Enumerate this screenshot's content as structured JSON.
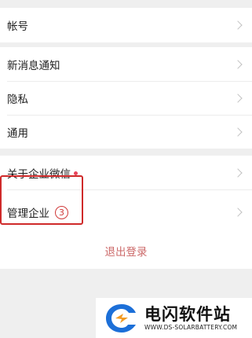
{
  "settings": {
    "group1": [
      {
        "label": "帐号"
      }
    ],
    "group2": [
      {
        "label": "新消息通知"
      },
      {
        "label": "隐私"
      },
      {
        "label": "通用"
      }
    ],
    "group3": [
      {
        "label": "关于企业微信",
        "has_dot": true
      },
      {
        "label": "管理企业",
        "step_badge": "3"
      }
    ]
  },
  "logout_label": "退出登录",
  "watermark": {
    "title": "电闪软件站",
    "url": "WWW.DS-SOLARBATTERY.COM"
  },
  "colors": {
    "accent_red": "#e8455b",
    "highlight_red": "#cf2a2a",
    "logout_text": "#cc6a6a",
    "logo_blue": "#1c6fd8",
    "logo_orange": "#f29b24"
  }
}
